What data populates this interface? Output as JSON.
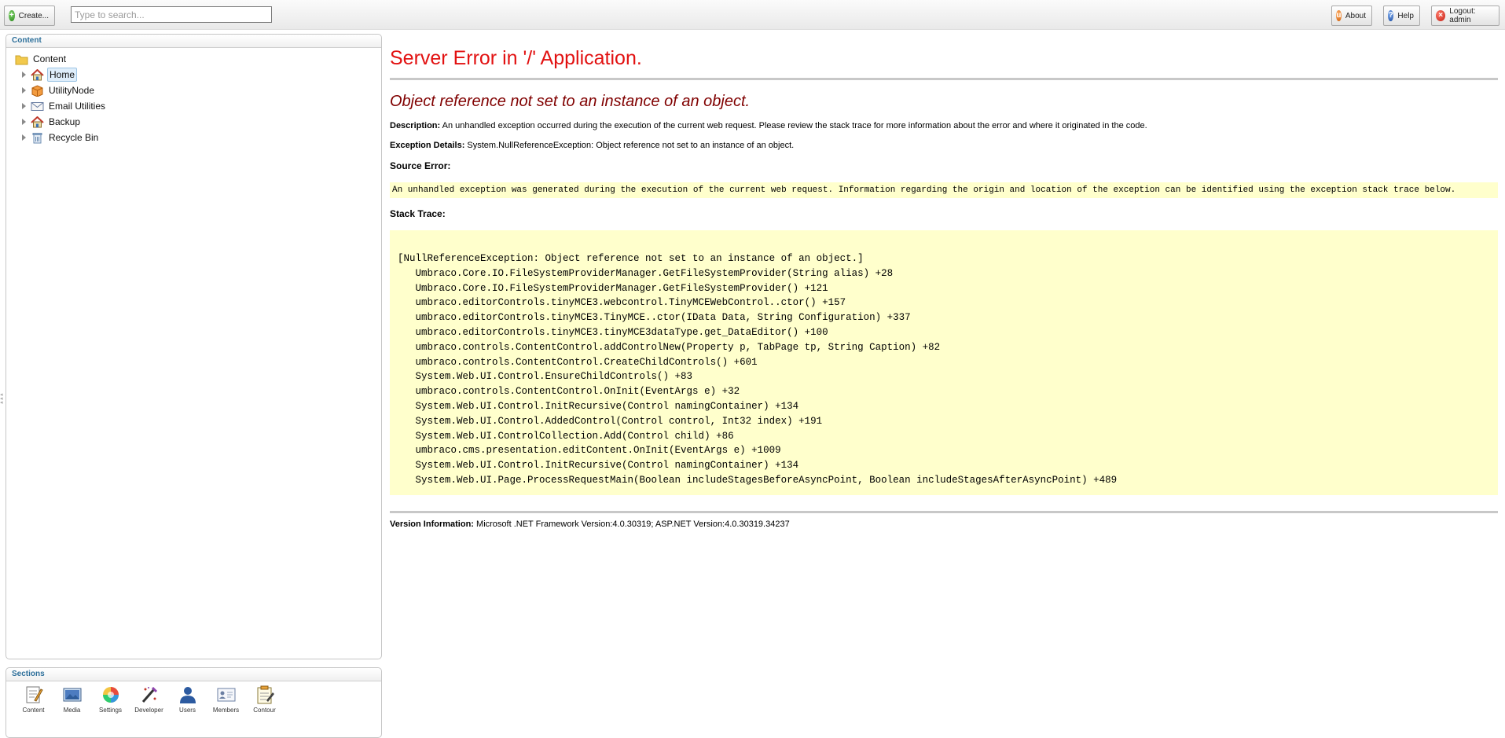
{
  "toolbar": {
    "create_label": "Create...",
    "search_placeholder": "Type to search...",
    "about_label": "About",
    "help_label": "Help",
    "logout_label": "Logout: admin"
  },
  "content_panel": {
    "title": "Content",
    "root_label": "Content",
    "items": [
      {
        "label": "Home",
        "icon": "home-icon",
        "selected": true
      },
      {
        "label": "UtilityNode",
        "icon": "box-icon"
      },
      {
        "label": "Email Utilities",
        "icon": "envelope-icon"
      },
      {
        "label": "Backup",
        "icon": "home-icon"
      },
      {
        "label": "Recycle Bin",
        "icon": "recycle-bin-icon"
      }
    ]
  },
  "sections_panel": {
    "title": "Sections",
    "items": [
      {
        "label": "Content",
        "icon": "content-icon"
      },
      {
        "label": "Media",
        "icon": "media-icon"
      },
      {
        "label": "Settings",
        "icon": "settings-icon"
      },
      {
        "label": "Developer",
        "icon": "developer-icon"
      },
      {
        "label": "Users",
        "icon": "users-icon"
      },
      {
        "label": "Members",
        "icon": "members-icon"
      },
      {
        "label": "Contour",
        "icon": "contour-icon"
      }
    ]
  },
  "error": {
    "title": "Server Error in '/' Application.",
    "message": "Object reference not set to an instance of an object.",
    "description_label": "Description:",
    "description_text": " An unhandled exception occurred during the execution of the current web request. Please review the stack trace for more information about the error and where it originated in the code.",
    "exception_label": "Exception Details:",
    "exception_text": " System.NullReferenceException: Object reference not set to an instance of an object.",
    "source_error_label": "Source Error:",
    "source_error_text": "An unhandled exception was generated during the execution of the current web request. Information regarding the origin and location of the exception can be identified using the exception stack trace below.",
    "stack_trace_label": "Stack Trace:",
    "stack_trace": [
      "[NullReferenceException: Object reference not set to an instance of an object.]",
      "   Umbraco.Core.IO.FileSystemProviderManager.GetFileSystemProvider(String alias) +28",
      "   Umbraco.Core.IO.FileSystemProviderManager.GetFileSystemProvider() +121",
      "   umbraco.editorControls.tinyMCE3.webcontrol.TinyMCEWebControl..ctor() +157",
      "   umbraco.editorControls.tinyMCE3.TinyMCE..ctor(IData Data, String Configuration) +337",
      "   umbraco.editorControls.tinyMCE3.tinyMCE3dataType.get_DataEditor() +100",
      "   umbraco.controls.ContentControl.addControlNew(Property p, TabPage tp, String Caption) +82",
      "   umbraco.controls.ContentControl.CreateChildControls() +601",
      "   System.Web.UI.Control.EnsureChildControls() +83",
      "   umbraco.controls.ContentControl.OnInit(EventArgs e) +32",
      "   System.Web.UI.Control.InitRecursive(Control namingContainer) +134",
      "   System.Web.UI.Control.AddedControl(Control control, Int32 index) +191",
      "   System.Web.UI.ControlCollection.Add(Control child) +86",
      "   umbraco.cms.presentation.editContent.OnInit(EventArgs e) +1009",
      "   System.Web.UI.Control.InitRecursive(Control namingContainer) +134",
      "   System.Web.UI.Page.ProcessRequestMain(Boolean includeStagesBeforeAsyncPoint, Boolean includeStagesAfterAsyncPoint) +489"
    ],
    "version_label": "Version Information:",
    "version_text": " Microsoft .NET Framework Version:4.0.30319; ASP.NET Version:4.0.30319.34237"
  }
}
